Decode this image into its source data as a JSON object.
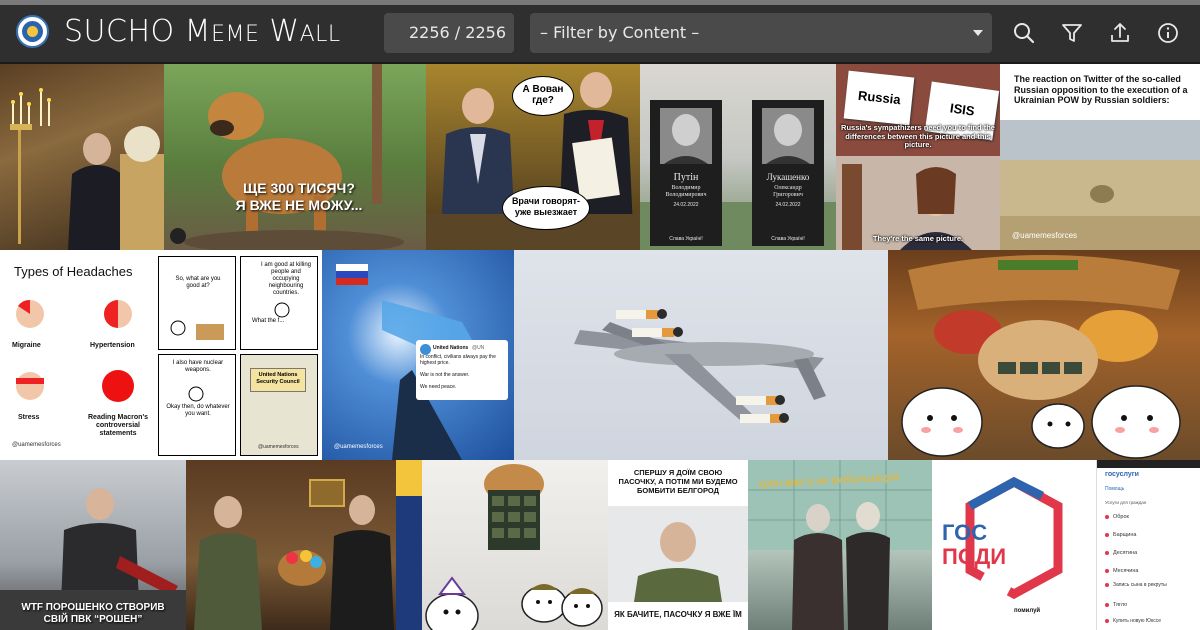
{
  "header": {
    "title_first": "SUCHO",
    "title_rest_M": "M",
    "title_rest_eme": "EME",
    "title_rest_W": "W",
    "title_rest_all": "ALL",
    "counter": "2256 / 2256",
    "filter_placeholder": "– Filter by Content –",
    "icons": [
      "search-icon",
      "filter-icon",
      "upload-icon",
      "info-icon"
    ]
  },
  "tiles": {
    "dog": {
      "caption": "ЩЕ 300 ТИСЯЧ?\nЯ ВЖЕ НЕ МОЖУ..."
    },
    "duma": {
      "bubble1": "А Вован\nгде?",
      "bubble2": "Врачи говорят-\nуже выезжает"
    },
    "graves": {
      "left_name": "Путін",
      "left_sub": "Володимир\nВолодимирович",
      "left_date": "24.02.2022",
      "right_name": "Лукашенко",
      "right_sub": "Олександр\nГригорович",
      "right_date": "24.02.2022",
      "epitaph": "Слава Україні!"
    },
    "office": {
      "card1": "Russia",
      "card2": "ISIS",
      "caption_top": "Russia's sympathizers need you to find the differences between this picture and this picture.",
      "caption_bottom": "They're the same picture."
    },
    "twitter": {
      "title": "The reaction on Twitter of the so-called Russian opposition to the execution of a Ukrainian POW by Russian soldiers:",
      "handle": "@uamemesforces"
    },
    "headaches": {
      "title": "Types of Headaches",
      "items": [
        "Migraine",
        "Hypertension",
        "Stress",
        "Reading Macron's controversial statements"
      ],
      "handle": "@uamemesforces"
    },
    "comic": {
      "p1": "So, what are you good at?",
      "p2": "I am good at killing people and occupying neighbouring countries.",
      "p2b": "What the f...",
      "p3": "I also have nuclear weapons.",
      "p3b": "Okay then, do whatever you want.",
      "p4": "United Nations Security Council",
      "handle": "@uamemesforces"
    },
    "pistol": {
      "tweet_name": "United Nations",
      "tweet_handle": "@UN",
      "tweet_text": "In conflict, civilians always pay the highest price.",
      "tweet_line2": "War is not the answer.",
      "tweet_line3": "We need peace.",
      "handle": "@uamemesforces"
    },
    "poroshenko": {
      "caption": "WTF ПОРОШЕНКО СТВОРИВ\nСВІЙ ПВК “РОШЕН”"
    },
    "zaluzhny": {
      "top": "СПЕРШУ Я ДОЇМ СВОЮ ПАСОЧКУ, А ПОТІМ МИ БУДЕМО БОМБИТИ БЕЛГОРОД",
      "bottom": "ЯК БАЧИТЕ, ПАСОЧКУ Я ВЖЕ ЇМ"
    },
    "women": {
      "caption": "хрен вам а не мобилизация"
    },
    "gos": {
      "line1": "ГОС",
      "line2": "ПОДИ",
      "sub": "помилуй"
    },
    "phone": {
      "logo": "госуслуги",
      "search": "Помощь",
      "section": "Услуги для граждан",
      "items": [
        "Оброк",
        "Барщина",
        "Десятина",
        "Месячина",
        "Запись сына в рекруты",
        "Тягло",
        "Купить новую Юкссе"
      ]
    }
  },
  "colors": {
    "header_bg": "#2f2f2f",
    "field_bg": "#4a4a4a",
    "accent_blue": "#2b64ae"
  }
}
